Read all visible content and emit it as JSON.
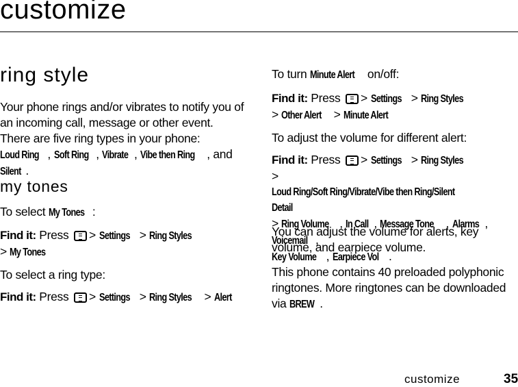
{
  "header": {
    "title": "customize"
  },
  "left": {
    "ring_style": {
      "heading": "ring style",
      "intro": "Your phone rings and/or vibrates to notify you of an incoming call, message or other event. There are five ring types in your phone:",
      "types": [
        "Loud Ring",
        "Soft Ring",
        "Vibrate",
        "Vibe then Ring",
        "Silent"
      ],
      "and": "and"
    },
    "my_tones": {
      "heading": "my tones",
      "select_prefix": "To select",
      "select_item": "My Tones",
      "find_label": "Find it:",
      "press": "Press",
      "path1": [
        "Settings",
        "Ring Styles",
        "My Tones"
      ],
      "ring_type_text": "To select a ring type:",
      "path2": [
        "Settings",
        "Ring Styles",
        "Alert"
      ]
    }
  },
  "right": {
    "minute_prefix": "To turn",
    "minute_item": "Minute Alert",
    "minute_suffix": "on/off:",
    "find_label": "Find it:",
    "press": "Press",
    "path1": [
      "Settings",
      "Ring Styles",
      "Other Alert",
      "Minute Alert"
    ],
    "volume_text": "To adjust the volume for different alert:",
    "path2": [
      "Settings",
      "Ring Styles",
      "Loud Ring/Soft Ring/Vibrate/Vibe then Ring/Silent Detail"
    ],
    "path2_items": [
      "Ring Volume",
      "In Call",
      "Message Tone",
      "Alarms",
      "Voicemail",
      "Key Volume",
      "Earpiece Vol"
    ],
    "adjust_text": "You can adjust the volume for alerts, key volume, and earpiece volume.",
    "ringtones_text": "This phone contains 40 preloaded polyphonic ringtones. More ringtones can be downloaded via",
    "brew": "BREW"
  },
  "footer": {
    "section": "customize",
    "page": "35"
  },
  "icons": {
    "menu_key": "menu-key-icon"
  }
}
